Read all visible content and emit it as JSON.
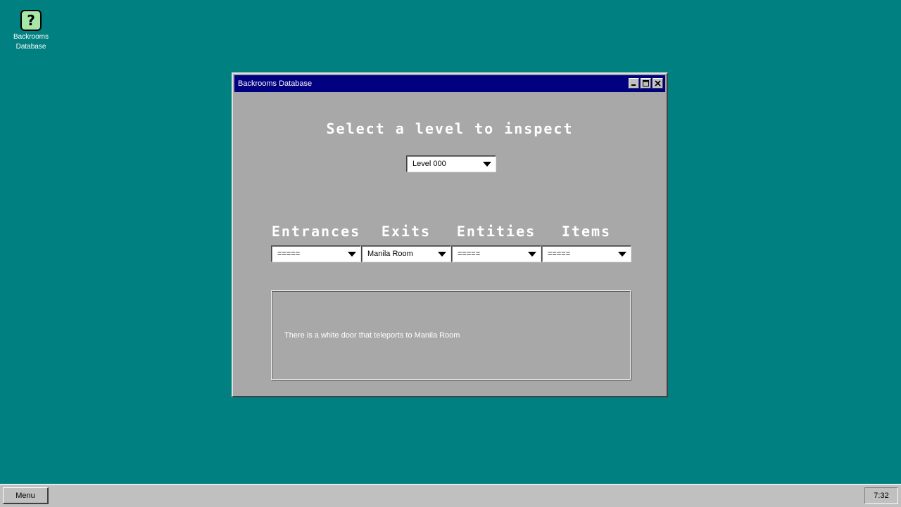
{
  "desktop": {
    "icon": {
      "label_line1": "Backrooms",
      "label_line2": "Database",
      "glyph": "?",
      "icon_name": "help-question-icon"
    },
    "background_color": "#008080"
  },
  "window": {
    "title": "Backrooms Database",
    "heading": "Select a level to inspect",
    "level_select": {
      "selected": "Level 000"
    },
    "columns": [
      {
        "heading": "Entrances",
        "selected": "====="
      },
      {
        "heading": "Exits",
        "selected": "Manila Room"
      },
      {
        "heading": "Entities",
        "selected": "====="
      },
      {
        "heading": "Items",
        "selected": "====="
      }
    ],
    "description": "There is a white door that teleports to Manila Room",
    "titlebar_color": "#000080"
  },
  "taskbar": {
    "menu_label": "Menu",
    "clock": "7:32"
  }
}
